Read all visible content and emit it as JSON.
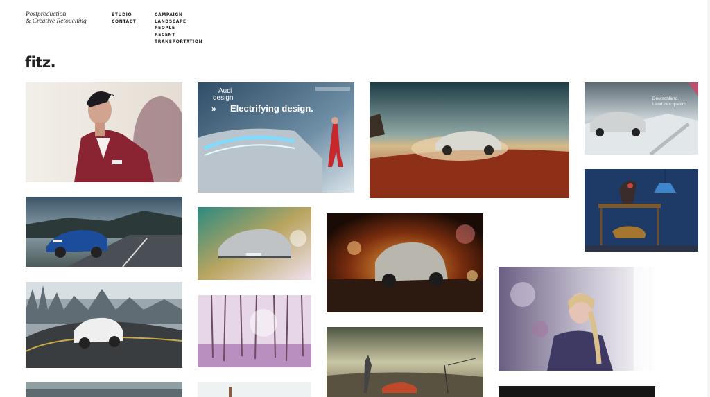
{
  "tagline": {
    "line1": "Postproduction",
    "line2": "& Creative Retouching"
  },
  "nav_studio": [
    "STUDIO",
    "CONTACT"
  ],
  "nav_work": [
    "CAMPAIGN",
    "LANDSCAPE",
    "PEOPLE",
    "RECENT",
    "TRANSPORTATION"
  ],
  "logo": "fitz.",
  "tiles": {
    "audi": {
      "brand": "Audi",
      "brand2": "design",
      "headline": "Electrifying design."
    },
    "a6": {
      "headline": "Deutschland.",
      "sub": "Land des quattro."
    },
    "golf": {
      "plate": "GO-LF 2013"
    }
  }
}
